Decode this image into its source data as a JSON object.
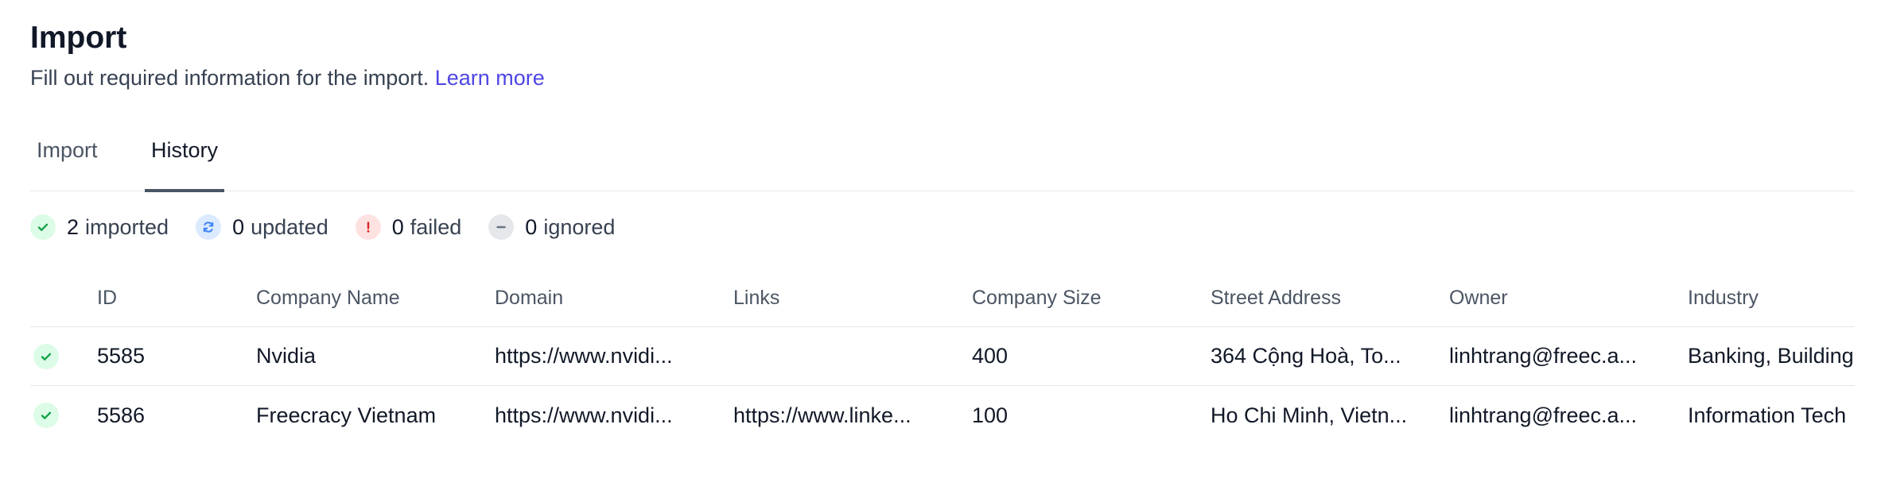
{
  "page": {
    "title": "Import",
    "subtitle": "Fill out required information for the import.",
    "learn_more": "Learn more"
  },
  "tabs": [
    {
      "label": "Import",
      "active": false
    },
    {
      "label": "History",
      "active": true
    }
  ],
  "stats": {
    "imported": {
      "count": "2",
      "label": "imported",
      "icon": "check-icon",
      "color": "#16a34a"
    },
    "updated": {
      "count": "0",
      "label": "updated",
      "icon": "refresh-icon",
      "color": "#3b82f6"
    },
    "failed": {
      "count": "0",
      "label": "failed",
      "icon": "exclamation-icon",
      "color": "#dc2626"
    },
    "ignored": {
      "count": "0",
      "label": "ignored",
      "icon": "minus-icon",
      "color": "#6b7280"
    }
  },
  "table": {
    "columns": [
      "ID",
      "Company Name",
      "Domain",
      "Links",
      "Company Size",
      "Street Address",
      "Owner",
      "Industry"
    ],
    "rows": [
      {
        "status": "check-icon",
        "id": "5585",
        "company_name": "Nvidia",
        "domain": "https://www.nvidi...",
        "links": "",
        "company_size": "400",
        "street_address": "364 Cộng Hoà, To...",
        "owner": "linhtrang@freec.a...",
        "industry": "Banking, Building"
      },
      {
        "status": "check-icon",
        "id": "5586",
        "company_name": "Freecracy Vietnam",
        "domain": "https://www.nvidi...",
        "links": "https://www.linke...",
        "company_size": "100",
        "street_address": "Ho Chi Minh, Vietn...",
        "owner": "linhtrang@freec.a...",
        "industry": "Information Tech"
      }
    ]
  }
}
